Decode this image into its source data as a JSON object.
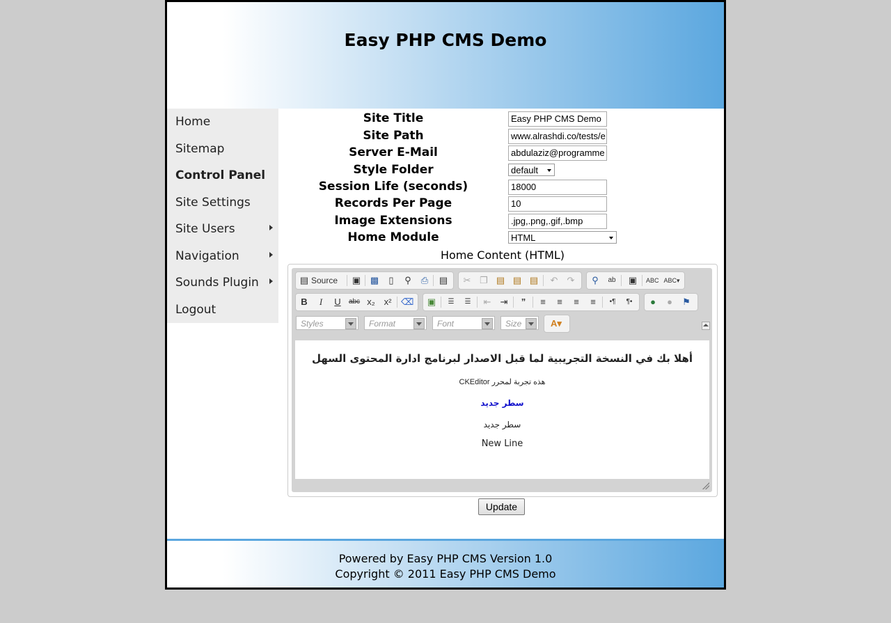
{
  "header": {
    "site_name": "Easy PHP CMS Demo"
  },
  "sidebar": {
    "items": [
      {
        "label": "Home",
        "has_submenu": false
      },
      {
        "label": "Sitemap",
        "has_submenu": false
      },
      {
        "label": "Control Panel",
        "has_submenu": false,
        "active": true
      },
      {
        "label": "Site Settings",
        "has_submenu": false
      },
      {
        "label": "Site Users",
        "has_submenu": true
      },
      {
        "label": "Navigation",
        "has_submenu": true
      },
      {
        "label": "Sounds Plugin",
        "has_submenu": true
      },
      {
        "label": "Logout",
        "has_submenu": false
      }
    ]
  },
  "settings": {
    "site_title": {
      "label": "Site Title",
      "value": "Easy PHP CMS Demo"
    },
    "site_path": {
      "label": "Site Path",
      "value": "www.alrashdi.co/tests/e"
    },
    "server_email": {
      "label": "Server E-Mail",
      "value": "abdulaziz@programme"
    },
    "style_folder": {
      "label": "Style Folder",
      "value": "default"
    },
    "session_life": {
      "label": "Session Life (seconds)",
      "value": "18000"
    },
    "records_per_page": {
      "label": "Records Per Page",
      "value": "10"
    },
    "image_extensions": {
      "label": "Image Extensions",
      "value": ".jpg,.png,.gif,.bmp"
    },
    "home_module": {
      "label": "Home Module",
      "value": "HTML"
    }
  },
  "home_content": {
    "title": "Home Content (HTML)",
    "toolbar": {
      "source_label": "Source",
      "styles_placeholder": "Styles",
      "format_placeholder": "Format",
      "font_placeholder": "Font",
      "size_placeholder": "Size"
    },
    "content": {
      "heading": "أهلا بك في النسخة التجريبية لما قبل الاصدار لبرنامج ادارة المحتوى السهل",
      "line1": "هذه تجربة لمحرر  CKEditor",
      "line2": "سطر جديد",
      "line3": "سطر جديد",
      "line4": "New Line"
    }
  },
  "update_label": "Update",
  "footer": {
    "powered": "Powered by Easy PHP CMS Version 1.0",
    "copyright": "Copyright © 2011 Easy PHP CMS Demo"
  },
  "colors": {
    "accent": "#5ba7df",
    "sidebar_bg": "#ececec",
    "page_bg": "#cccccc"
  }
}
